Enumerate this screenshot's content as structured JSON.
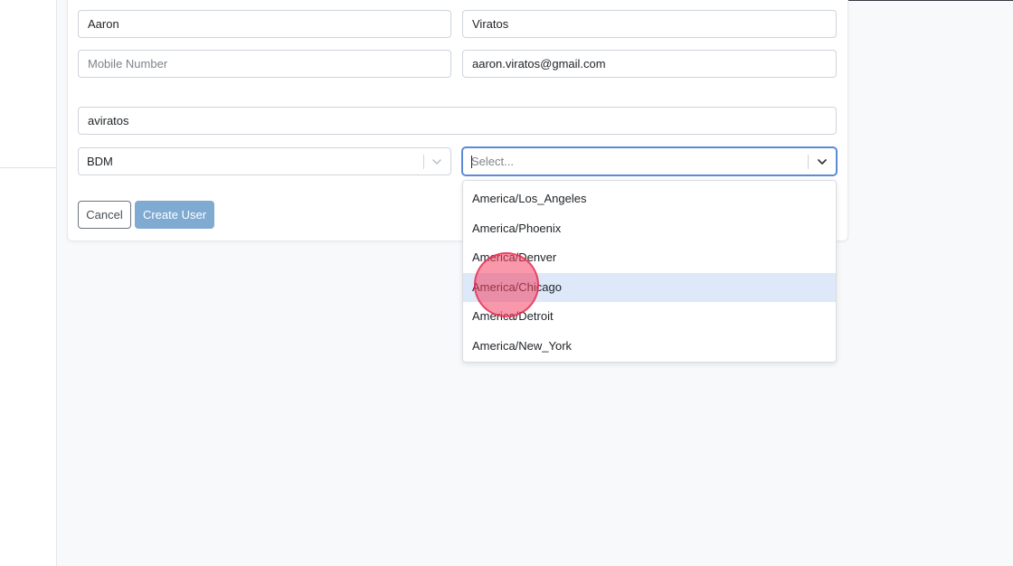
{
  "form": {
    "first_name": "Aaron",
    "last_name": "Viratos",
    "mobile_placeholder": "Mobile Number",
    "email": "aaron.viratos@gmail.com",
    "username": "aviratos",
    "role_select": {
      "value": "BDM"
    },
    "timezone_select": {
      "placeholder": "Select..."
    }
  },
  "buttons": {
    "cancel_label": "Cancel",
    "create_label": "Create User"
  },
  "timezone_menu": {
    "options": [
      {
        "label": "America/Los_Angeles"
      },
      {
        "label": "America/Phoenix"
      },
      {
        "label": "America/Denver"
      },
      {
        "label": "America/Chicago",
        "highlighted": true
      },
      {
        "label": "America/Detroit"
      },
      {
        "label": "America/New_York"
      }
    ]
  },
  "colors": {
    "primary_disabled": "#7faad2",
    "focus_border": "#5b8bd6",
    "option_highlight": "#dde8f8",
    "click_indicator": "#f44364"
  }
}
